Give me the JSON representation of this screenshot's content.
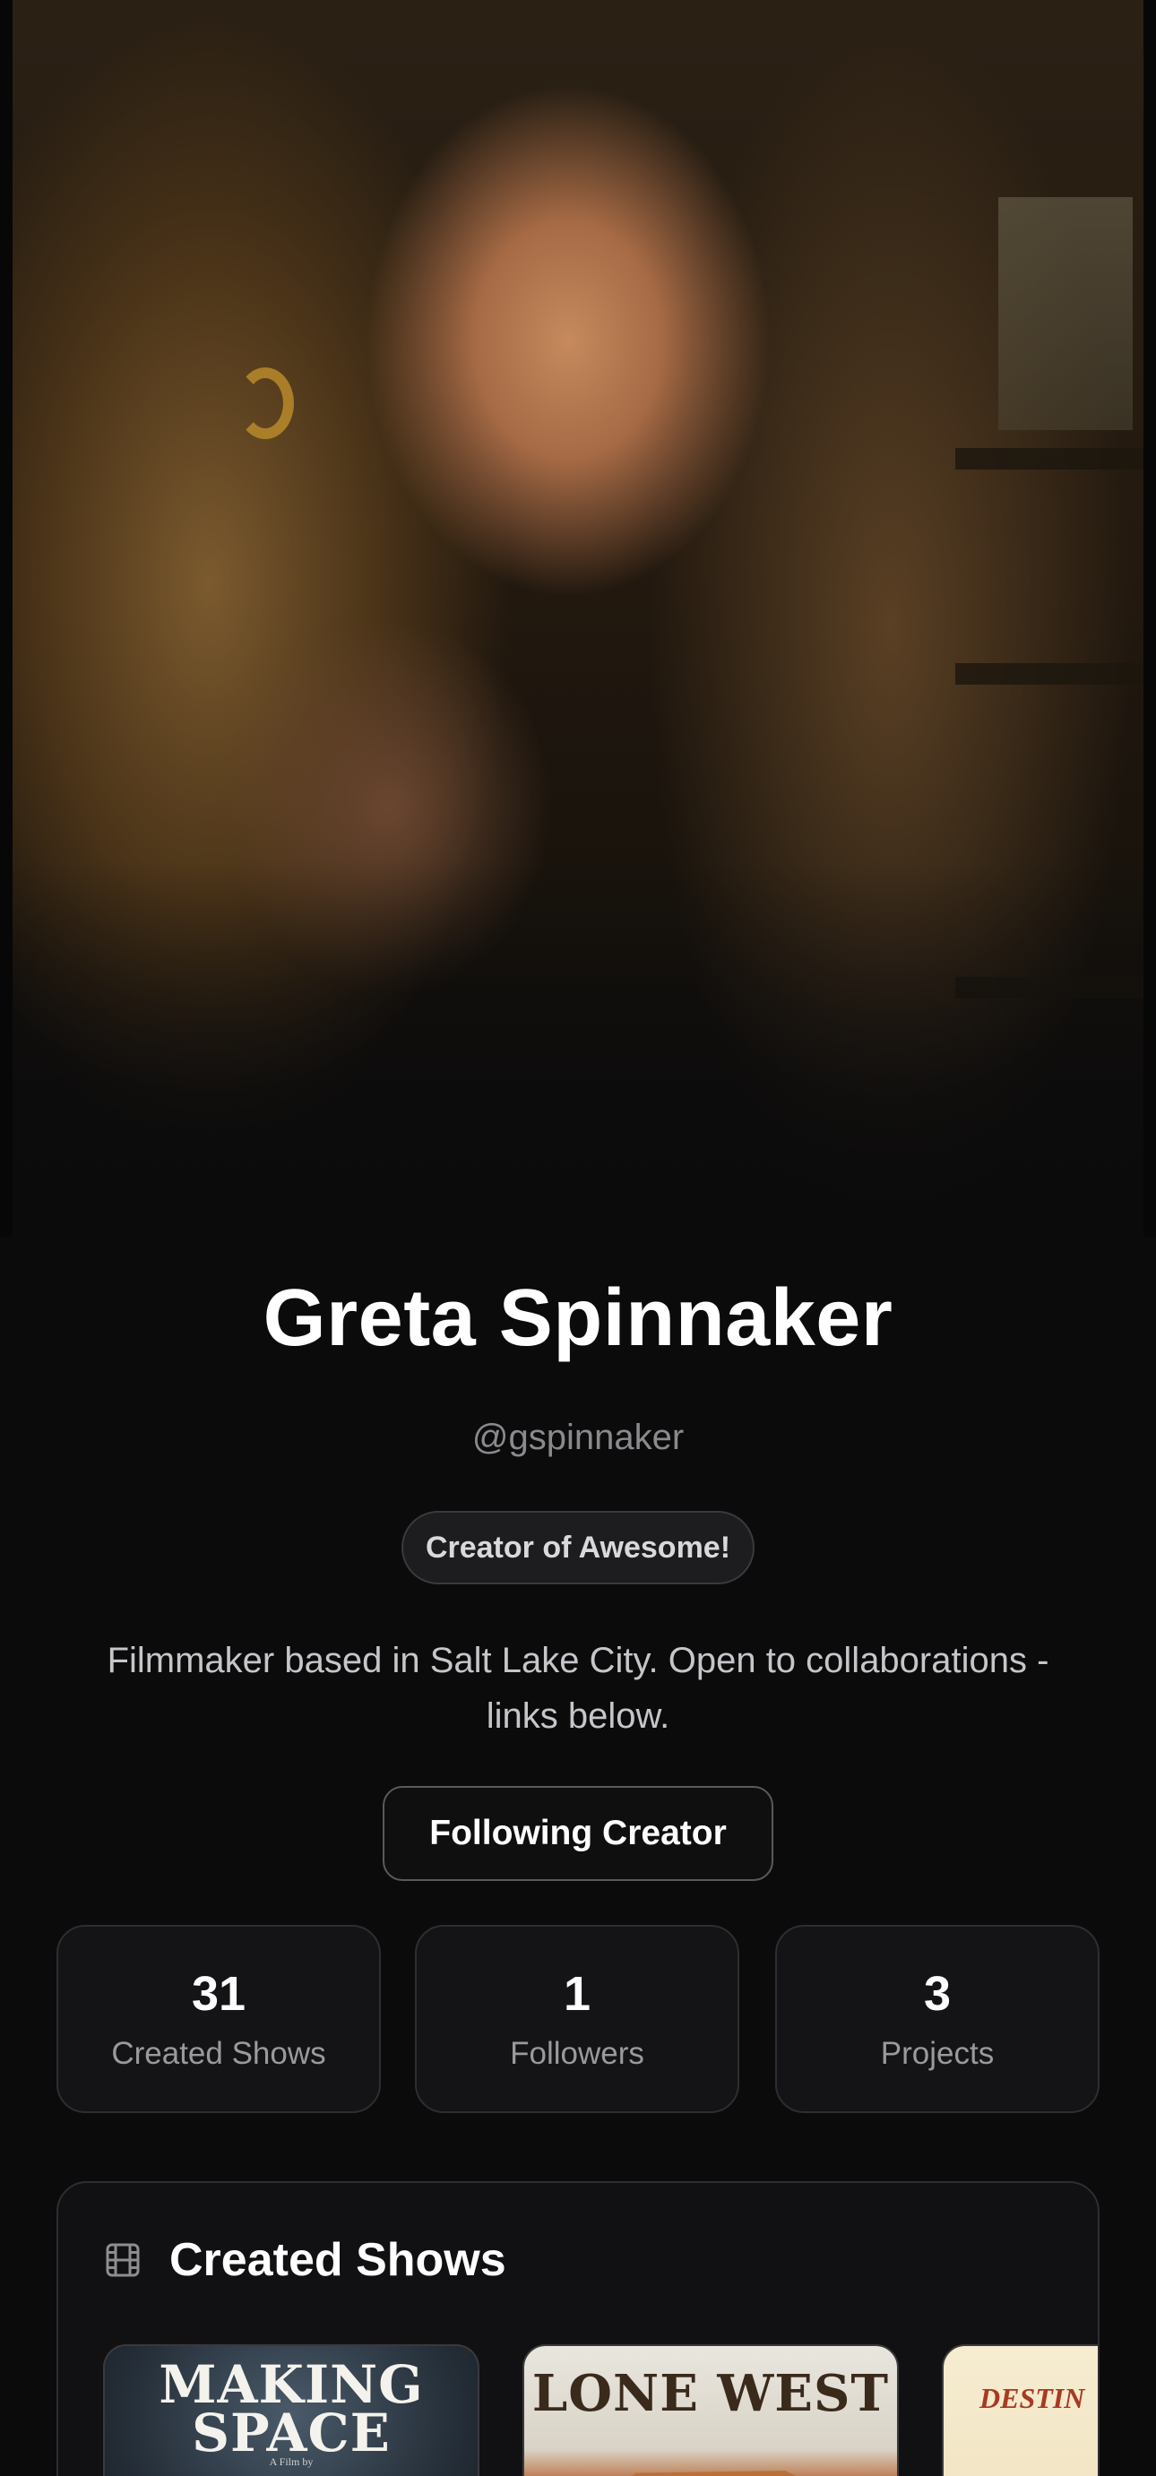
{
  "profile": {
    "name": "Greta Spinnaker",
    "handle": "@gspinnaker",
    "badge": "Creator of Awesome!",
    "bio": "Filmmaker based in Salt Lake City. Open to collaborations - links below.",
    "follow_button": "Following Creator"
  },
  "stats": [
    {
      "value": "31",
      "label": "Created Shows"
    },
    {
      "value": "1",
      "label": "Followers"
    },
    {
      "value": "3",
      "label": "Projects"
    }
  ],
  "created_shows": {
    "title": "Created Shows",
    "icon": "film-icon",
    "posters": [
      {
        "title_line1": "MAKING",
        "title_line2": "SPACE",
        "subtitle": "A Film by"
      },
      {
        "title": "LONE WEST"
      },
      {
        "title": "DESTIN"
      }
    ]
  },
  "colors": {
    "background": "#0b0b0c",
    "card": "#141416",
    "border": "#2e2e32",
    "muted_text": "#8a8a8e"
  }
}
